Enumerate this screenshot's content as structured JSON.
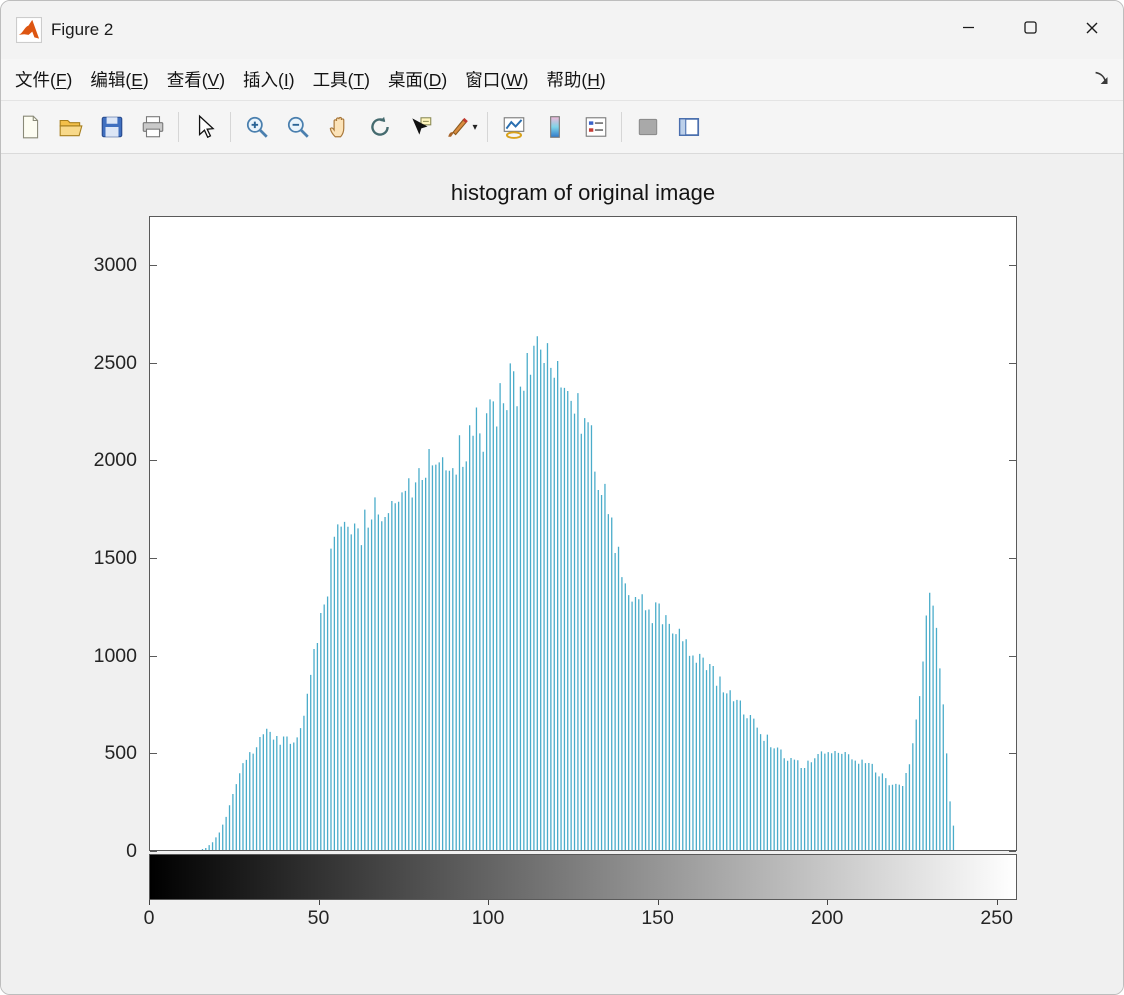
{
  "window": {
    "title": "Figure 2",
    "controls": [
      {
        "name": "minimize-button",
        "icon": "minimize-icon"
      },
      {
        "name": "maximize-button",
        "icon": "maximize-icon"
      },
      {
        "name": "close-button",
        "icon": "close-icon"
      }
    ]
  },
  "menu": {
    "items": [
      {
        "name": "menu-file",
        "text": "文件",
        "key": "F"
      },
      {
        "name": "menu-edit",
        "text": "编辑",
        "key": "E"
      },
      {
        "name": "menu-view",
        "text": "查看",
        "key": "V"
      },
      {
        "name": "menu-insert",
        "text": "插入",
        "key": "I"
      },
      {
        "name": "menu-tools",
        "text": "工具",
        "key": "T"
      },
      {
        "name": "menu-desktop",
        "text": "桌面",
        "key": "D"
      },
      {
        "name": "menu-window",
        "text": "窗口",
        "key": "W"
      },
      {
        "name": "menu-help",
        "text": "帮助",
        "key": "H"
      }
    ]
  },
  "toolbar": {
    "buttons": [
      {
        "name": "new-figure-button",
        "icon": "new-document-icon"
      },
      {
        "name": "open-file-button",
        "icon": "open-folder-icon"
      },
      {
        "name": "save-figure-button",
        "icon": "save-icon"
      },
      {
        "name": "print-figure-button",
        "icon": "print-icon",
        "separator_after": true
      },
      {
        "name": "edit-plot-button",
        "icon": "edit-cursor-icon",
        "separator_after": true
      },
      {
        "name": "zoom-in-button",
        "icon": "zoom-in-icon"
      },
      {
        "name": "zoom-out-button",
        "icon": "zoom-out-icon"
      },
      {
        "name": "pan-button",
        "icon": "pan-icon"
      },
      {
        "name": "rotate-3d-button",
        "icon": "rotate-3d-icon"
      },
      {
        "name": "data-cursor-button",
        "icon": "data-cursor-icon"
      },
      {
        "name": "brush-button",
        "icon": "brush-icon",
        "dropdown": true,
        "separator_after": true
      },
      {
        "name": "link-plot-button",
        "icon": "link-plot-icon"
      },
      {
        "name": "insert-colorbar-button",
        "icon": "insert-colorbar-icon"
      },
      {
        "name": "insert-legend-button",
        "icon": "insert-legend-icon",
        "separator_after": true
      },
      {
        "name": "hide-plot-tools-button",
        "icon": "hide-plot-tools-icon"
      },
      {
        "name": "show-plot-tools-button",
        "icon": "show-plot-tools-icon"
      }
    ]
  },
  "chart_data": {
    "type": "bar",
    "title": "histogram of original image",
    "xlabel": "",
    "ylabel": "",
    "xlim": [
      0,
      255
    ],
    "ylim": [
      0,
      3250
    ],
    "yticks": [
      0,
      500,
      1000,
      1500,
      2000,
      2500,
      3000
    ],
    "xticks": [
      0,
      50,
      100,
      150,
      200,
      250
    ],
    "bar_color": "#4aacca",
    "colorbar": "grayscale gradient strip from black (0) to white (255)",
    "grid": false,
    "bin_start": 0,
    "bin_step": 2,
    "values": [
      0,
      0,
      0,
      0,
      0,
      0,
      0,
      0,
      10,
      40,
      90,
      170,
      290,
      400,
      455,
      505,
      565,
      615,
      580,
      555,
      575,
      550,
      615,
      790,
      1015,
      1190,
      1370,
      1610,
      1635,
      1665,
      1715,
      1645,
      1725,
      1765,
      1695,
      1765,
      1805,
      1865,
      1925,
      1875,
      1965,
      2015,
      1975,
      2065,
      1985,
      2015,
      2065,
      2115,
      2165,
      2095,
      2215,
      2265,
      2315,
      2425,
      2355,
      2465,
      2525,
      2570,
      2495,
      2555,
      2515,
      2475,
      2395,
      2295,
      2195,
      2095,
      1945,
      1795,
      1645,
      1515,
      1405,
      1335,
      1295,
      1265,
      1215,
      1260,
      1165,
      1115,
      1150,
      1065,
      1015,
      985,
      950,
      905,
      860,
      815,
      785,
      750,
      710,
      660,
      610,
      565,
      530,
      505,
      480,
      455,
      435,
      445,
      470,
      500,
      520,
      505,
      488,
      472,
      465,
      460,
      440,
      405,
      380,
      350,
      325,
      335,
      430,
      650,
      1000,
      1370,
      1150,
      750,
      250,
      0,
      0,
      0,
      0,
      0,
      0,
      0,
      0,
      0
    ]
  }
}
